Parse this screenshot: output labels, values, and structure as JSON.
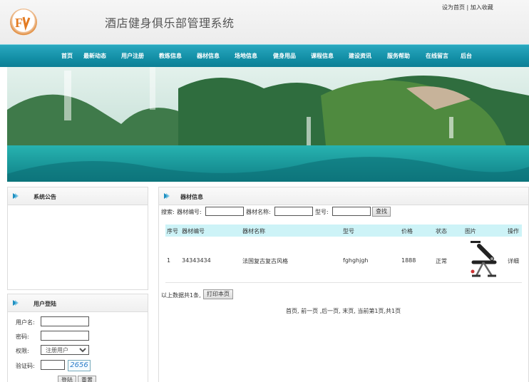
{
  "header": {
    "title": "酒店健身俱乐部管理系统",
    "top_links": {
      "home": "设为首页",
      "sep": "|",
      "fav": "加入收藏"
    }
  },
  "nav": {
    "items": [
      "首页",
      "最新动态",
      "用户注册",
      "教练信息",
      "器材信息",
      "场地信息",
      "健身用品",
      "课程信息",
      "建设资讯",
      "服务帮助",
      "在线留言",
      "后台"
    ]
  },
  "colors": {
    "nav": "#1496ad",
    "table_head": "#cdf3f7",
    "captcha": "#2a7cc8"
  },
  "sidebar": {
    "notice_title": "系统公告",
    "login": {
      "title": "用户登陆",
      "username_label": "用户名:",
      "password_label": "密码:",
      "role_label": "权限:",
      "role_value": "注册用户",
      "captcha_label": "验证码:",
      "captcha_code": "2656",
      "login_button": "登陆",
      "reset_button": "重置"
    }
  },
  "main": {
    "title": "器材信息",
    "search": {
      "prefix": "搜索:",
      "code_label": "器材编号:",
      "name_label": "器材名称:",
      "model_label": "型号:",
      "button": "查找"
    },
    "columns": [
      "序号",
      "器材编号",
      "器材名称",
      "型号",
      "价格",
      "状态",
      "图片",
      "操作"
    ],
    "rows": [
      {
        "index": "1",
        "code": "34343434",
        "name": "法国复古复古风格",
        "model": "fghghjgh",
        "price": "1888",
        "status": "正常",
        "image": "fitness-bench-image",
        "action": "详细"
      }
    ],
    "summary": "以上数据共1条,",
    "print_button": "打印本页",
    "pager": "首页, 前一页 ,后一页, 末页, 当前第1页,共1页"
  }
}
